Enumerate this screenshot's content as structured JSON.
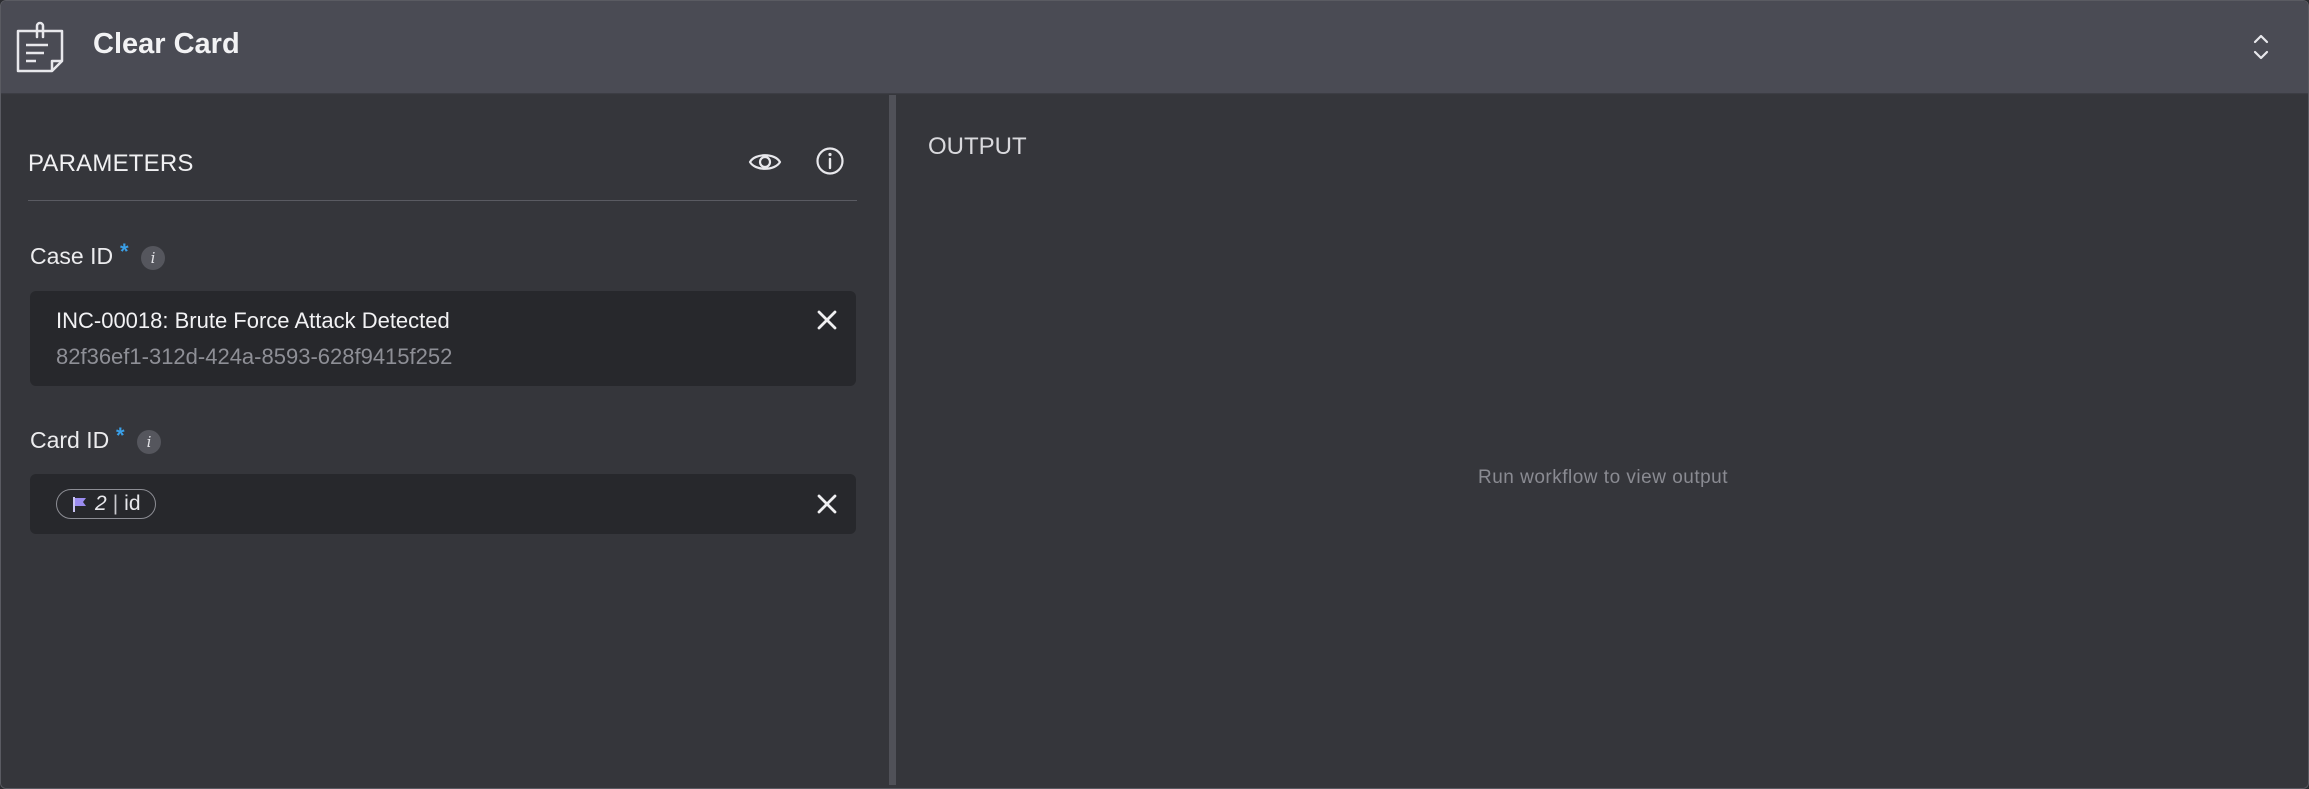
{
  "header": {
    "title": "Clear Card",
    "icon": "sticky-note-icon",
    "collapse_icon": "chevron-up-down-icon"
  },
  "parameters": {
    "title": "PARAMETERS",
    "preview_icon": "eye-icon",
    "info_icon": "info-circle-icon",
    "fields": {
      "case_id": {
        "label": "Case ID",
        "required_mark": "*",
        "info_mark": "i",
        "value_name": "INC-00018: Brute Force Attack Detected",
        "value_uuid": "82f36ef1-312d-424a-8593-628f9415f252"
      },
      "card_id": {
        "label": "Card ID",
        "required_mark": "*",
        "info_mark": "i",
        "chip_number": "2",
        "chip_separator": "|",
        "chip_field": "id"
      }
    }
  },
  "output": {
    "title": "OUTPUT",
    "placeholder": "Run workflow to view output"
  },
  "colors": {
    "header_bg": "#4a4b54",
    "panel_bg": "#35363b",
    "field_bg": "#27282c",
    "required_accent": "#3aa0e8",
    "chip_flag": "#9b8cf0"
  }
}
